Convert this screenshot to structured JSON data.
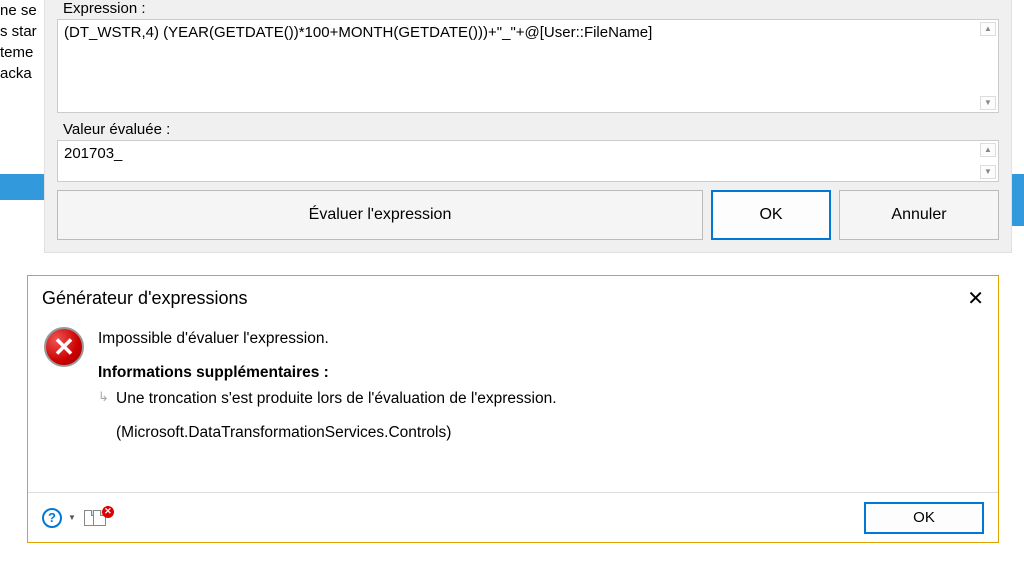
{
  "background_text": [
    "ne se",
    "s star",
    "teme",
    "acka"
  ],
  "main": {
    "expression_label": "Expression :",
    "expression_value": "(DT_WSTR,4) (YEAR(GETDATE())*100+MONTH(GETDATE()))+\"_\"+@[User::FileName]",
    "evaluated_label": "Valeur évaluée :",
    "evaluated_value": "201703_",
    "evaluate_btn": "Évaluer l'expression",
    "ok_btn": "OK",
    "cancel_btn": "Annuler"
  },
  "msg": {
    "title": "Générateur d'expressions",
    "line1": "Impossible d'évaluer l'expression.",
    "additional_label": "Informations supplémentaires :",
    "detail": "Une troncation s'est produite lors de l'évaluation de l'expression.",
    "source": "(Microsoft.DataTransformationServices.Controls)",
    "ok_btn": "OK"
  }
}
